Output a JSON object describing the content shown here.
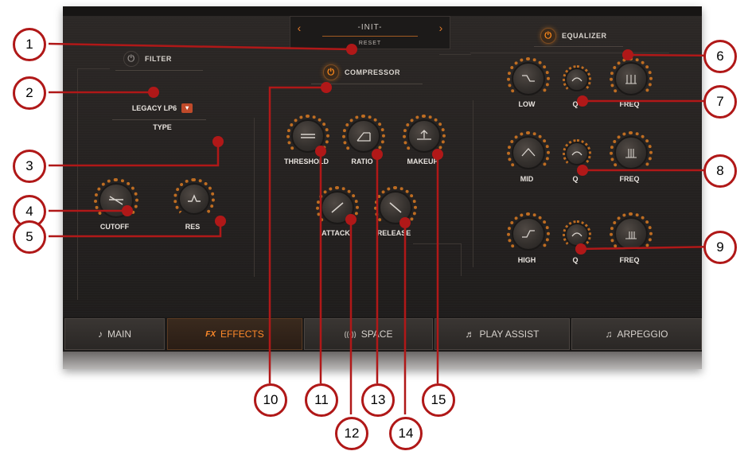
{
  "preset": {
    "name": "-INIT-",
    "sub": "RESET",
    "prev": "‹",
    "next": "›"
  },
  "filter": {
    "title": "FILTER",
    "type_value": "LEGACY LP6",
    "type_label": "TYPE",
    "knobs": {
      "cutoff": "CUTOFF",
      "res": "RES"
    }
  },
  "compressor": {
    "title": "COMPRESSOR",
    "knobs": {
      "threshold": "THRESHOLD",
      "ratio": "RATIO",
      "makeup": "MAKEUP",
      "attack": "ATTACK",
      "release": "RELEASE"
    }
  },
  "equalizer": {
    "title": "EQUALIZER",
    "bands": [
      {
        "name": "LOW",
        "q": "Q",
        "freq": "FREQ"
      },
      {
        "name": "MID",
        "q": "Q",
        "freq": "FREQ"
      },
      {
        "name": "HIGH",
        "q": "Q",
        "freq": "FREQ"
      }
    ]
  },
  "tabs": [
    {
      "label": "MAIN",
      "icon": "guitar-icon",
      "glyph": "♪"
    },
    {
      "label": "EFFECTS",
      "icon": "fx-icon",
      "glyph": "FX"
    },
    {
      "label": "SPACE",
      "icon": "space-icon",
      "glyph": "((◦))"
    },
    {
      "label": "PLAY ASSIST",
      "icon": "play-assist-icon",
      "glyph": "♬"
    },
    {
      "label": "ARPEGGIO",
      "icon": "arpeggio-icon",
      "glyph": "♫"
    }
  ],
  "callouts": [
    "1",
    "2",
    "3",
    "4",
    "5",
    "6",
    "7",
    "8",
    "9",
    "10",
    "11",
    "12",
    "13",
    "14",
    "15"
  ],
  "colors": {
    "accent": "#ff8a1a",
    "callout": "#b01818",
    "panel": "#2a2624"
  }
}
